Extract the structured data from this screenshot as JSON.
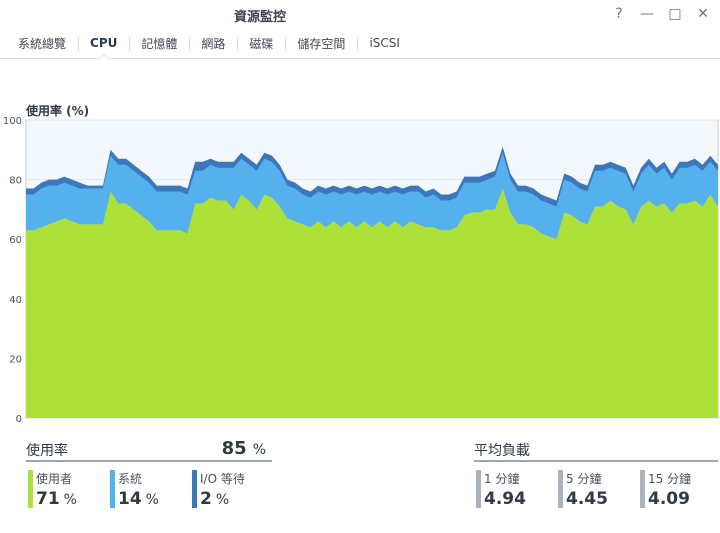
{
  "window": {
    "title": "資源監控",
    "help_glyph": "?",
    "minimize_glyph": "—",
    "maximize_glyph": "□",
    "close_glyph": "✕"
  },
  "tabs": [
    {
      "label": "系統總覽",
      "active": false
    },
    {
      "label": "CPU",
      "active": true
    },
    {
      "label": "記憶體",
      "active": false
    },
    {
      "label": "網路",
      "active": false
    },
    {
      "label": "磁碟",
      "active": false
    },
    {
      "label": "儲存空間",
      "active": false
    },
    {
      "label": "iSCSI",
      "active": false
    }
  ],
  "chart_data": {
    "type": "area",
    "title": "使用率 (%)",
    "ylim": [
      0,
      100
    ],
    "yticks": [
      "0",
      "20",
      "40",
      "60",
      "80",
      "100"
    ],
    "grid": true,
    "stacked": true,
    "colors": {
      "user": "#aee03a",
      "system": "#55b0ee",
      "io_wait": "#3a78bb",
      "background": "#f3f8fc",
      "grid": "#dde6ee"
    },
    "series": [
      {
        "key": "user",
        "values": [
          63,
          63,
          64,
          65,
          66,
          67,
          66,
          65,
          65,
          65,
          65,
          76,
          72,
          72,
          70,
          68,
          66,
          63,
          63,
          63,
          63,
          62,
          72,
          72,
          74,
          73,
          73,
          70,
          75,
          73,
          70,
          75,
          74,
          71,
          67,
          66,
          65,
          64,
          66,
          64,
          66,
          64,
          66,
          64,
          66,
          64,
          66,
          64,
          66,
          64,
          66,
          65,
          64,
          64,
          63,
          63,
          64,
          68,
          69,
          69,
          70,
          70,
          77,
          69,
          65,
          65,
          64,
          62,
          61,
          60,
          69,
          68,
          66,
          65,
          71,
          71,
          73,
          71,
          70,
          65,
          71,
          73,
          71,
          72,
          69,
          72,
          72,
          73,
          71,
          75,
          71
        ]
      },
      {
        "key": "system",
        "values": [
          12,
          12,
          13,
          13,
          12,
          12,
          12,
          12,
          12,
          12,
          12,
          12,
          13,
          13,
          13,
          13,
          13,
          13,
          13,
          13,
          13,
          13,
          11,
          11,
          11,
          11,
          11,
          14,
          12,
          12,
          13,
          12,
          12,
          12,
          11,
          11,
          10,
          10,
          10,
          11,
          10,
          11,
          10,
          11,
          10,
          11,
          10,
          11,
          10,
          11,
          10,
          11,
          10,
          11,
          10,
          10,
          10,
          11,
          10,
          10,
          10,
          11,
          12,
          11,
          11,
          11,
          11,
          11,
          11,
          11,
          11,
          11,
          11,
          11,
          12,
          12,
          11,
          12,
          12,
          11,
          11,
          12,
          11,
          12,
          11,
          12,
          12,
          12,
          12,
          11,
          12
        ]
      },
      {
        "key": "io_wait",
        "values": [
          2,
          2,
          2,
          2,
          2,
          2,
          2,
          2,
          1,
          1,
          1,
          2,
          2,
          2,
          2,
          2,
          2,
          2,
          2,
          2,
          2,
          2,
          3,
          3,
          2,
          2,
          2,
          2,
          2,
          2,
          2,
          2,
          2,
          2,
          2,
          2,
          2,
          2,
          2,
          2,
          2,
          2,
          2,
          2,
          2,
          2,
          2,
          2,
          2,
          2,
          2,
          2,
          2,
          2,
          2,
          2,
          2,
          2,
          2,
          2,
          2,
          2,
          2,
          2,
          2,
          2,
          2,
          2,
          2,
          2,
          2,
          2,
          2,
          2,
          2,
          2,
          2,
          2,
          2,
          2,
          2,
          2,
          2,
          2,
          2,
          2,
          2,
          2,
          2,
          2,
          2
        ]
      }
    ]
  },
  "usage": {
    "title": "使用率",
    "total_value": "85",
    "total_unit": "%",
    "stats": [
      {
        "label": "使用者",
        "value": "71",
        "unit": "%",
        "color": "#aee03a"
      },
      {
        "label": "系統",
        "value": "14",
        "unit": "%",
        "color": "#55b0ee"
      },
      {
        "label": "I/O 等待",
        "value": "2",
        "unit": "%",
        "color": "#3a78bb"
      }
    ]
  },
  "load": {
    "title": "平均負載",
    "stats": [
      {
        "label": "1 分鐘",
        "value": "4.94",
        "color": "#aab3bd"
      },
      {
        "label": "5 分鐘",
        "value": "4.45",
        "color": "#aab3bd"
      },
      {
        "label": "15 分鐘",
        "value": "4.09",
        "color": "#aab3bd"
      }
    ]
  }
}
